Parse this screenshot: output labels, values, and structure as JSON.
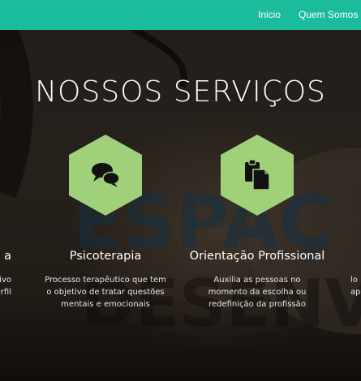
{
  "nav": {
    "items": [
      {
        "label": "Inicio"
      },
      {
        "label": "Quem Somos"
      }
    ]
  },
  "services": {
    "heading": "NOSSOS SERVIÇOS",
    "items": [
      {
        "title": "a",
        "desc_lines": [
          "tivo",
          "erfil"
        ],
        "icon": "partial"
      },
      {
        "title": "Psicoterapia",
        "desc_lines": [
          "Processo terapêutico que tem",
          "o objetivo de tratar questões",
          "mentais e emocionais"
        ],
        "icon": "chat-bubbles-icon"
      },
      {
        "title": "Orientação Profissional",
        "desc_lines": [
          "Auxilia as pessoas no",
          "momento da escolha ou",
          "redefinição da profissão"
        ],
        "icon": "clipboard-icon"
      },
      {
        "title": "",
        "desc_lines": [
          "lo",
          "ap"
        ],
        "icon": "partial"
      }
    ]
  },
  "colors": {
    "nav": "#1abc9c",
    "hex": "#a0d07a"
  }
}
